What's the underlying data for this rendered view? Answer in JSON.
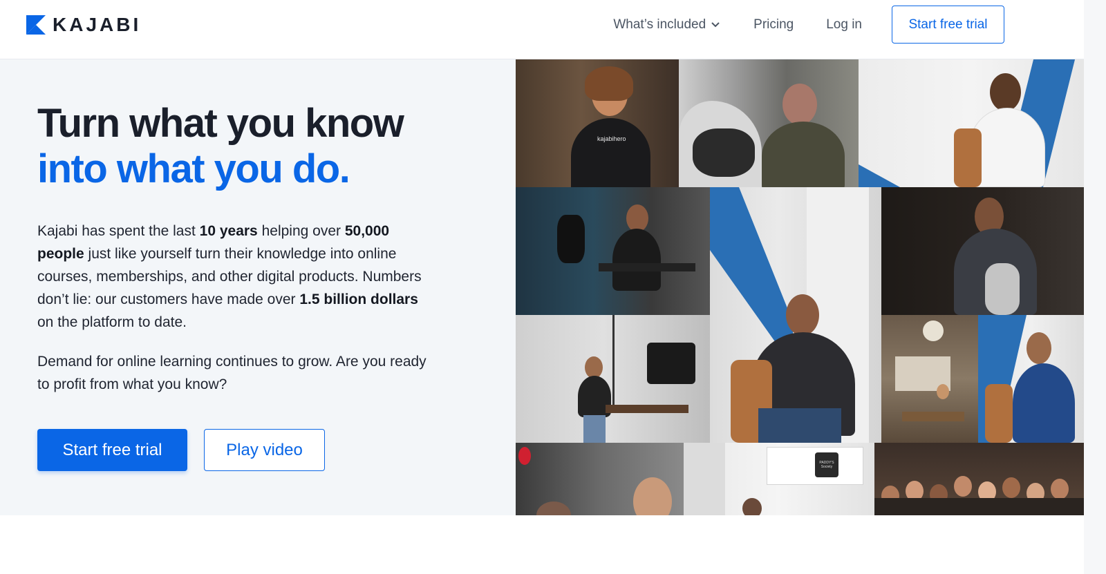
{
  "brand": {
    "name": "KAJABI",
    "accent": "#0a66e6"
  },
  "nav": {
    "whats_included": "What’s included",
    "pricing": "Pricing",
    "login": "Log in",
    "cta": "Start free trial"
  },
  "hero": {
    "headline_line1": "Turn what you know",
    "headline_line2": "into what you do.",
    "p1": {
      "t1": "Kajabi has spent the last ",
      "b1": "10 years",
      "t2": " helping over ",
      "b2": "50,000 people",
      "t3": " just like yourself turn their knowledge into online courses, memberships, and other digital products. Numbers don’t lie: our customers have made over ",
      "b3": "1.5 billion dollars",
      "t4": " on the platform to date."
    },
    "p2": "Demand for online learning continues to grow. Are you ready to profit from what you know?",
    "primary_button": "Start free trial",
    "secondary_button": "Play video"
  },
  "photos": {
    "shirt_text": "kajabihero",
    "sign_text": "PADDY'S Society"
  }
}
